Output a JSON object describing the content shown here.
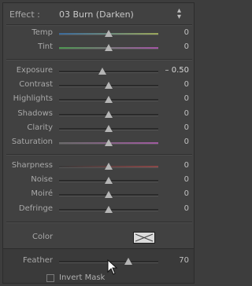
{
  "effect": {
    "label": "Effect :",
    "preset": "03 Burn (Darken)",
    "arrows_icon": "up-down-arrows-icon"
  },
  "color_section": {
    "temp": {
      "label": "Temp",
      "value": "0",
      "level": 0.5
    },
    "tint": {
      "label": "Tint",
      "value": "0",
      "level": 0.5
    }
  },
  "tone": {
    "exposure": {
      "label": "Exposure",
      "value": "– 0.50",
      "level": 0.44
    },
    "contrast": {
      "label": "Contrast",
      "value": "0",
      "level": 0.5
    },
    "highlights": {
      "label": "Highlights",
      "value": "0",
      "level": 0.5
    },
    "shadows": {
      "label": "Shadows",
      "value": "0",
      "level": 0.5
    },
    "clarity": {
      "label": "Clarity",
      "value": "0",
      "level": 0.5
    },
    "saturation": {
      "label": "Saturation",
      "value": "0",
      "level": 0.5
    }
  },
  "detail": {
    "sharpness": {
      "label": "Sharpness",
      "value": "0",
      "level": 0.5
    },
    "noise": {
      "label": "Noise",
      "value": "0",
      "level": 0.5
    },
    "moire": {
      "label": "Moiré",
      "value": "0",
      "level": 0.5
    },
    "defringe": {
      "label": "Defringe",
      "value": "0",
      "level": 0.5
    }
  },
  "color": {
    "label": "Color",
    "swatch_icon": "no-color-swatch-icon"
  },
  "feather": {
    "label": "Feather",
    "value": "70",
    "level": 0.7
  },
  "invert_mask": {
    "label": "Invert Mask",
    "checked": false
  },
  "colors": {
    "panel_bg": "#414141",
    "knob": "#b5b5b5",
    "text": "#b8b8b8"
  }
}
